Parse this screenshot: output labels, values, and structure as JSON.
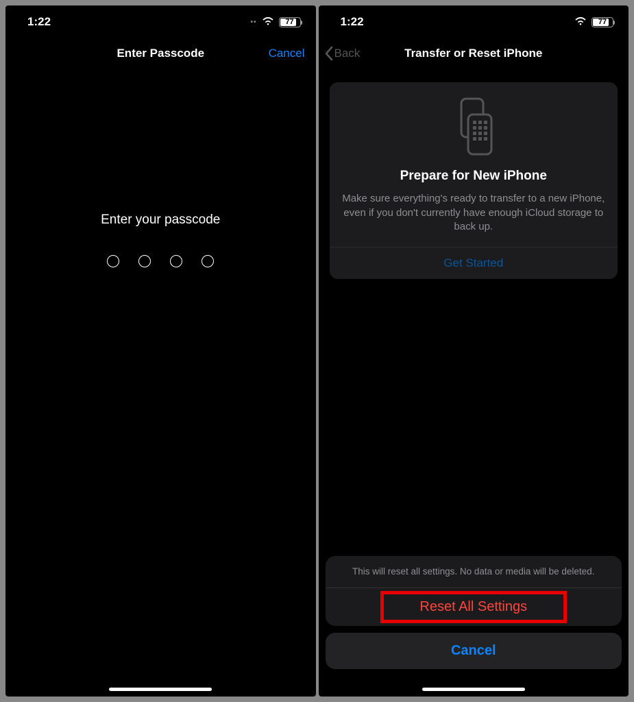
{
  "status": {
    "time": "1:22",
    "battery": "77"
  },
  "left": {
    "nav": {
      "title": "Enter Passcode",
      "cancel": "Cancel"
    },
    "prompt": "Enter your passcode"
  },
  "right": {
    "nav": {
      "back": "Back",
      "title": "Transfer or Reset iPhone"
    },
    "card": {
      "title": "Prepare for New iPhone",
      "desc": "Make sure everything's ready to transfer to a new iPhone, even if you don't currently have enough iCloud storage to back up.",
      "cta": "Get Started"
    },
    "sheet": {
      "message": "This will reset all settings. No data or media will be deleted.",
      "destructive": "Reset All Settings",
      "cancel": "Cancel"
    }
  }
}
